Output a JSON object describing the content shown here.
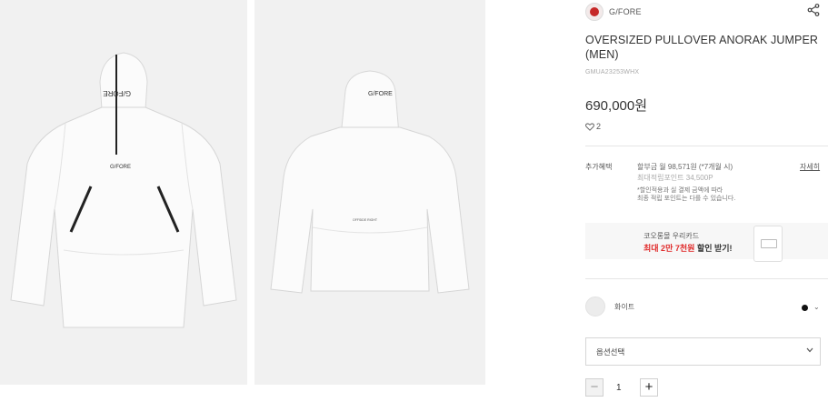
{
  "images": {
    "front": {
      "logo_text": "G/FORE"
    },
    "back": {
      "logo_text": "G/FORE",
      "panel_text": "OFFSIDE RIGHT"
    }
  },
  "brand": {
    "name": "G/FORE",
    "share_icon": "share-icon"
  },
  "product": {
    "title": "OVERSIZED PULLOVER ANORAK JUMPER (MEN)",
    "code": "GMUA23253WHX",
    "price": "690,000원",
    "likes": "2"
  },
  "benefits": {
    "label": "추가혜택",
    "installment": "할부금 월 98,571원 (*7개월 시)",
    "points": "최대적립포인트 34,500P",
    "note_1": "*할인적용과 실 결제 금액에 따라",
    "note_2": "최종 적립 포인트는 다를 수 있습니다.",
    "detail_link": "자세히"
  },
  "banner": {
    "line1": "코오롱몰 우리카드",
    "line2_prefix": "최대 2만 7천원",
    "line2_suffix": " 할인 받기!"
  },
  "color_option": {
    "name": "화이트",
    "swatch_color": "#111111"
  },
  "option_select": {
    "label": "옵션선택"
  },
  "quantity": {
    "minus": "−",
    "value": "1",
    "plus": "+"
  }
}
